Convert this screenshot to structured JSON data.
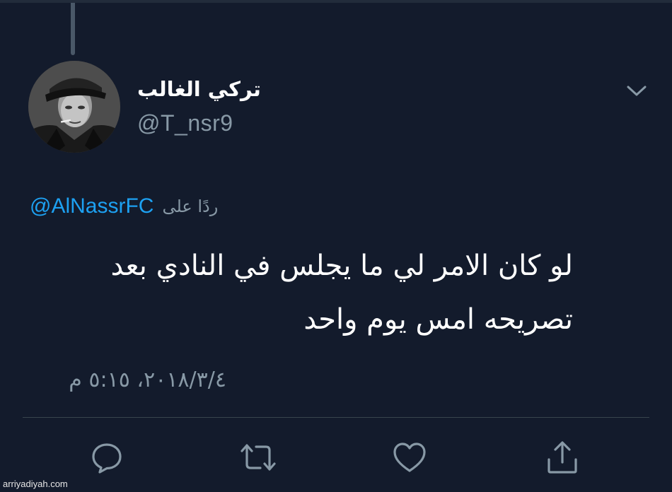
{
  "user": {
    "display_name": "تركي الغالب",
    "handle": "@T_nsr9"
  },
  "reply_context": {
    "prefix": "ردًا على",
    "mention": "@AlNassrFC"
  },
  "tweet": {
    "lines": [
      "لو كان الامر لي ما يجلس في النادي بعد",
      "تصريحه امس يوم واحد"
    ],
    "timestamp": "٢٠١٨/٣/٤، ٥:١٥ م"
  },
  "actions": {
    "icons": [
      "reply-icon",
      "retweet-icon",
      "like-icon",
      "share-icon"
    ]
  },
  "watermark": "arriyadiyah.com",
  "colors": {
    "background": "#131b2c",
    "text_primary": "#ffffff",
    "text_secondary": "#8899a6",
    "link": "#1da1f2",
    "divider": "#38444d"
  }
}
